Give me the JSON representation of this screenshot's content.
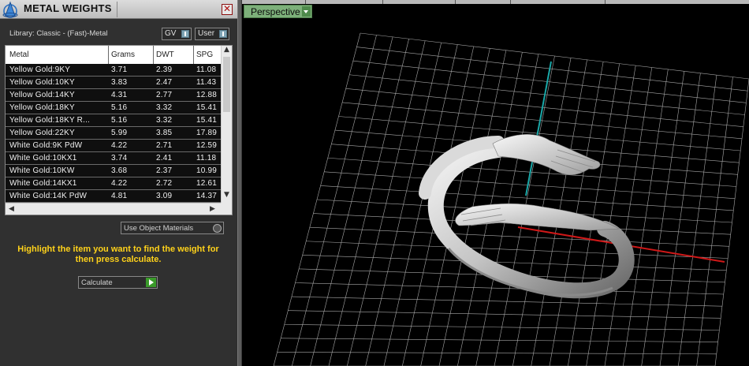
{
  "panel": {
    "title": "METAL WEIGHTS",
    "close_glyph": "✕",
    "library_label": "Library: Classic - (Fast)-Metal",
    "gv_select": "GV",
    "user_select": "User",
    "columns": [
      "Metal",
      "Grams",
      "DWT",
      "SPG"
    ],
    "rows": [
      {
        "metal": "Yellow Gold:9KY",
        "grams": "3.71",
        "dwt": "2.39",
        "spg": "11.08"
      },
      {
        "metal": "Yellow Gold:10KY",
        "grams": "3.83",
        "dwt": "2.47",
        "spg": "11.43"
      },
      {
        "metal": "Yellow Gold:14KY",
        "grams": "4.31",
        "dwt": "2.77",
        "spg": "12.88"
      },
      {
        "metal": "Yellow Gold:18KY",
        "grams": "5.16",
        "dwt": "3.32",
        "spg": "15.41"
      },
      {
        "metal": "Yellow Gold:18KY R...",
        "grams": "5.16",
        "dwt": "3.32",
        "spg": "15.41"
      },
      {
        "metal": "Yellow Gold:22KY",
        "grams": "5.99",
        "dwt": "3.85",
        "spg": "17.89"
      },
      {
        "metal": "White Gold:9K PdW",
        "grams": "4.22",
        "dwt": "2.71",
        "spg": "12.59"
      },
      {
        "metal": "White Gold:10KX1",
        "grams": "3.74",
        "dwt": "2.41",
        "spg": "11.18"
      },
      {
        "metal": "White Gold:10KW",
        "grams": "3.68",
        "dwt": "2.37",
        "spg": "10.99"
      },
      {
        "metal": "White Gold:14KX1",
        "grams": "4.22",
        "dwt": "2.72",
        "spg": "12.61"
      },
      {
        "metal": "White Gold:14K PdW",
        "grams": "4.81",
        "dwt": "3.09",
        "spg": "14.37"
      }
    ],
    "use_object_materials": "Use Object Materials",
    "hint": "Highlight the item you want to find the weight for then press calculate.",
    "calculate_label": "Calculate"
  },
  "viewport": {
    "view_label": "Perspective"
  },
  "colors": {
    "hint": "#ffd21a",
    "view_tab": "#7db07a",
    "grid": "#a8a8a8",
    "axis_x": "#d01818",
    "axis_y": "#1aa8a8"
  }
}
